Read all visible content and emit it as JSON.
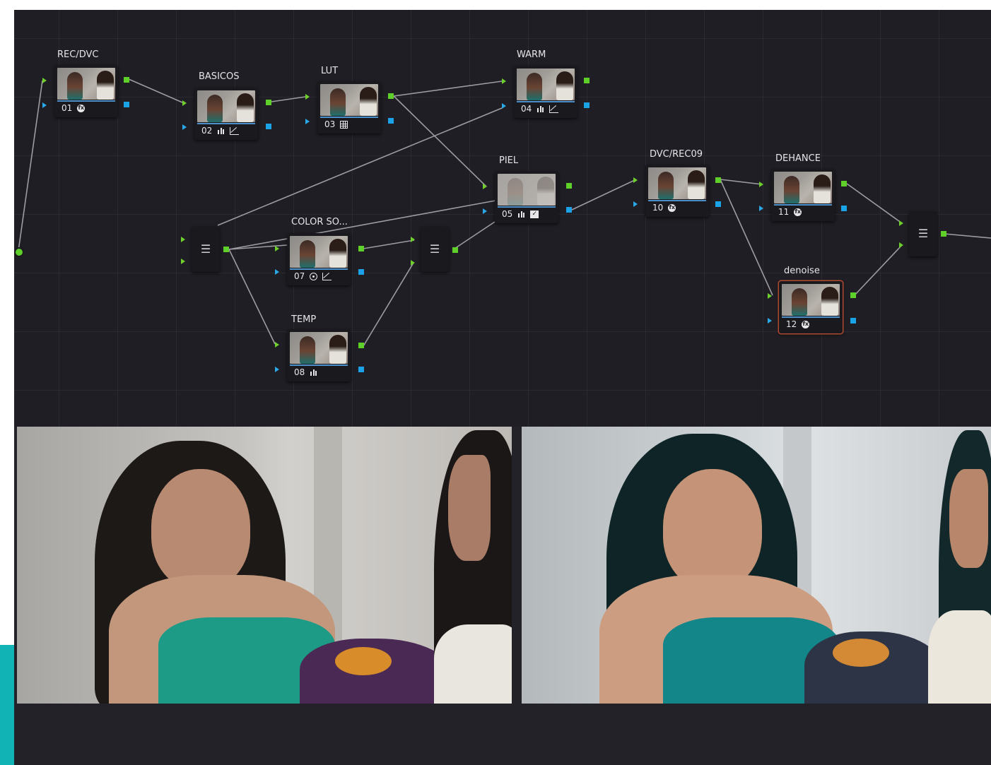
{
  "node_graph": {
    "nodes": [
      {
        "id": "01",
        "label": "REC/DVC",
        "tools": [
          "fx-icon"
        ]
      },
      {
        "id": "02",
        "label": "BASICOS",
        "tools": [
          "bars-icon",
          "curve-icon"
        ]
      },
      {
        "id": "03",
        "label": "LUT",
        "tools": [
          "grid-icon"
        ]
      },
      {
        "id": "04",
        "label": "WARM",
        "tools": [
          "bars-icon",
          "curve-icon"
        ]
      },
      {
        "id": "05",
        "label": "PIEL",
        "tools": [
          "bars-icon",
          "check-icon"
        ]
      },
      {
        "id": "07",
        "label": "COLOR SO...",
        "tools": [
          "ring-icon",
          "curve-icon"
        ]
      },
      {
        "id": "08",
        "label": "TEMP",
        "tools": [
          "bars-icon"
        ]
      },
      {
        "id": "10",
        "label": "DVC/REC09",
        "tools": [
          "fx-icon"
        ]
      },
      {
        "id": "11",
        "label": "DEHANCE",
        "tools": [
          "fx-icon"
        ]
      },
      {
        "id": "12",
        "label": "denoise",
        "tools": [
          "fx-icon"
        ],
        "selected": true
      }
    ],
    "mixers": [
      "layer-mixer-1",
      "layer-mixer-2",
      "layer-mixer-3"
    ],
    "colors": {
      "background": "#1f1e24",
      "rgb_port": "#5fcf2a",
      "alpha_port": "#1aa3e6",
      "selected_outline": "#b04a30",
      "wire": "#9c9ca2"
    }
  },
  "viewers": {
    "before_label": "",
    "after_label": "",
    "colors": {
      "before_wall": "#c9c7c3",
      "after_wall": "#cdd3d7",
      "before_top": "#1d9b86",
      "after_top": "#13868a",
      "accent_strip": "#11b3b5"
    }
  }
}
